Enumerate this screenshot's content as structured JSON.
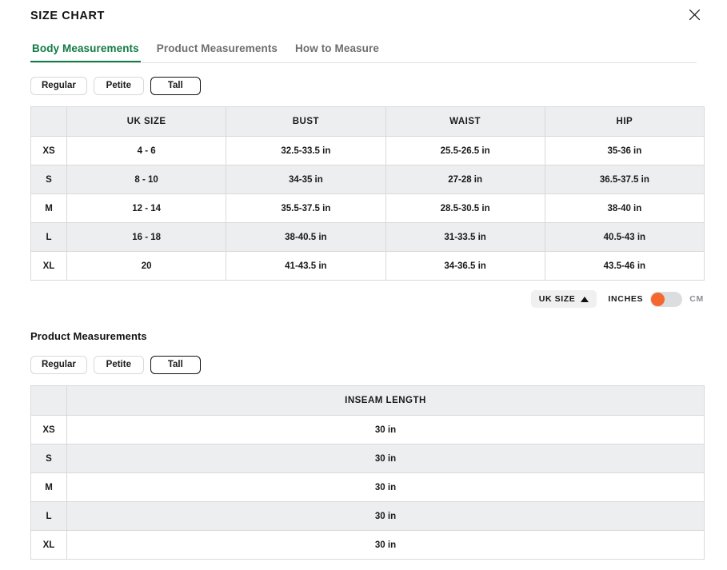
{
  "header": {
    "title": "SIZE CHART",
    "close_icon": "close-icon"
  },
  "tabs": [
    {
      "label": "Body Measurements",
      "active": true
    },
    {
      "label": "Product Measurements",
      "active": false
    },
    {
      "label": "How to Measure",
      "active": false
    }
  ],
  "body_section": {
    "fit_options": [
      {
        "label": "Regular",
        "selected": false
      },
      {
        "label": "Petite",
        "selected": false
      },
      {
        "label": "Tall",
        "selected": true
      }
    ],
    "table": {
      "columns": [
        "",
        "UK SIZE",
        "BUST",
        "WAIST",
        "HIP"
      ],
      "rows": [
        {
          "size": "XS",
          "values": [
            "4 - 6",
            "32.5-33.5 in",
            "25.5-26.5 in",
            "35-36 in"
          ]
        },
        {
          "size": "S",
          "values": [
            "8 - 10",
            "34-35 in",
            "27-28 in",
            "36.5-37.5 in"
          ]
        },
        {
          "size": "M",
          "values": [
            "12 - 14",
            "35.5-37.5 in",
            "28.5-30.5 in",
            "38-40 in"
          ]
        },
        {
          "size": "L",
          "values": [
            "16 - 18",
            "38-40.5 in",
            "31-33.5 in",
            "40.5-43 in"
          ]
        },
        {
          "size": "XL",
          "values": [
            "20",
            "41-43.5 in",
            "34-36.5 in",
            "43.5-46 in"
          ]
        }
      ]
    }
  },
  "controls": {
    "size_system_label": "UK SIZE",
    "size_system_caret": "caret-up-icon",
    "unit_left_label": "INCHES",
    "unit_right_label": "CM",
    "unit_selected": "INCHES",
    "toggle_knob_color": "#f4682f",
    "toggle_track_color": "#dcdddf"
  },
  "product_section": {
    "heading": "Product Measurements",
    "fit_options": [
      {
        "label": "Regular",
        "selected": false
      },
      {
        "label": "Petite",
        "selected": false
      },
      {
        "label": "Tall",
        "selected": true
      }
    ],
    "table": {
      "columns": [
        "",
        "INSEAM LENGTH"
      ],
      "rows": [
        {
          "size": "XS",
          "values": [
            "30 in"
          ]
        },
        {
          "size": "S",
          "values": [
            "30 in"
          ]
        },
        {
          "size": "M",
          "values": [
            "30 in"
          ]
        },
        {
          "size": "L",
          "values": [
            "30 in"
          ]
        },
        {
          "size": "XL",
          "values": [
            "30 in"
          ]
        }
      ]
    }
  },
  "colors": {
    "accent_green": "#127a43",
    "accent_orange": "#f4682f",
    "header_row_bg": "#eceef0",
    "inactive_tab": "#6e6e6e"
  }
}
